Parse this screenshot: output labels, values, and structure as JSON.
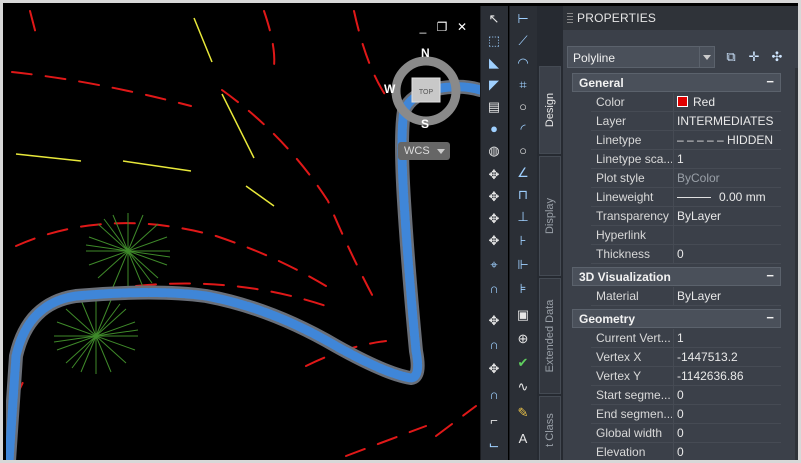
{
  "viewport": {
    "controls": {
      "minimize": "_",
      "restore": "❐",
      "close": "✕"
    },
    "viewcube": {
      "top_face": "TOP",
      "north": "N",
      "south": "S",
      "west": "W",
      "wcs_label": "WCS"
    }
  },
  "toolbars": {
    "left_icons": [
      "select-icon",
      "select-window-icon",
      "pick-icon",
      "pick-add-icon",
      "document-icon",
      "globe-color-icon",
      "globe-icon",
      "snap-icon",
      "snap-a-icon",
      "snap-cursor-icon",
      "snap-cross-icon",
      "pin-icon",
      "magnet-icon",
      "point-icon",
      "magnet2-icon",
      "point2-icon",
      "magnet3-icon",
      "line-icon",
      "pointer-icon"
    ],
    "right_icons": [
      "dimension-h-icon",
      "dimension-aligned-icon",
      "arc-icon",
      "point-dim-icon",
      "circle-icon",
      "arc2-icon",
      "circle2-icon",
      "angle-icon",
      "fence-icon",
      "dimension-base-icon",
      "dimension-cont-icon",
      "dimension-ord-icon",
      "dimension-center-icon",
      "frame-icon",
      "plus-circle-icon",
      "check-icon",
      "wave-icon",
      "pencil-icon",
      "text-icon"
    ]
  },
  "palette": {
    "title": "PROPERTIES",
    "tabs": [
      "Design",
      "Display",
      "Extended Data",
      "t Class"
    ],
    "active_tab": "Design",
    "object_type": "Polyline",
    "sections": [
      {
        "title": "General",
        "collapse_symbol": "−",
        "rows": [
          {
            "key": "Color",
            "value": "Red",
            "swatch": "#e00000"
          },
          {
            "key": "Layer",
            "value": "INTERMEDIATES"
          },
          {
            "key": "Linetype",
            "value": "– – – – –  HIDDEN"
          },
          {
            "key": "Linetype sca...",
            "value": "1"
          },
          {
            "key": "Plot style",
            "value": "ByColor",
            "dim": true
          },
          {
            "key": "Lineweight",
            "value": "0.00 mm"
          },
          {
            "key": "Transparency",
            "value": "ByLayer"
          },
          {
            "key": "Hyperlink",
            "value": ""
          },
          {
            "key": "Thickness",
            "value": "0"
          }
        ]
      },
      {
        "title": "3D Visualization",
        "collapse_symbol": "−",
        "rows": [
          {
            "key": "Material",
            "value": "ByLayer"
          }
        ]
      },
      {
        "title": "Geometry",
        "collapse_symbol": "−",
        "rows": [
          {
            "key": "Current Vert...",
            "value": "1"
          },
          {
            "key": "Vertex X",
            "value": "-1447513.2"
          },
          {
            "key": "Vertex Y",
            "value": "-1142636.86"
          },
          {
            "key": "Start segme...",
            "value": "0"
          },
          {
            "key": "End segmen...",
            "value": "0"
          },
          {
            "key": "Global width",
            "value": "0"
          },
          {
            "key": "Elevation",
            "value": "0"
          }
        ]
      }
    ]
  }
}
